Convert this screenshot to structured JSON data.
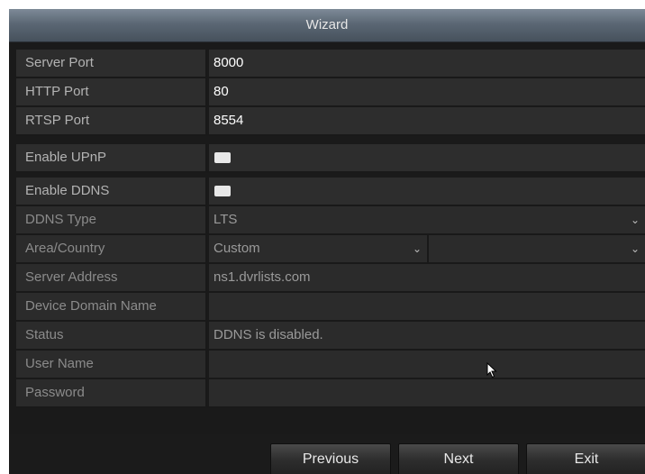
{
  "window": {
    "title": "Wizard"
  },
  "network": {
    "server_port": {
      "label": "Server Port",
      "value": "8000"
    },
    "http_port": {
      "label": "HTTP Port",
      "value": "80"
    },
    "rtsp_port": {
      "label": "RTSP Port",
      "value": "8554"
    }
  },
  "upnp": {
    "label": "Enable UPnP",
    "checked": false
  },
  "ddns": {
    "enable_label": "Enable DDNS",
    "enabled": false,
    "type": {
      "label": "DDNS Type",
      "value": "LTS"
    },
    "area": {
      "label": "Area/Country",
      "value": "Custom",
      "secondary_value": ""
    },
    "server_address": {
      "label": "Server Address",
      "value": "ns1.dvrlists.com"
    },
    "device_domain": {
      "label": "Device Domain Name",
      "value": ""
    },
    "status": {
      "label": "Status",
      "value": "DDNS is disabled."
    },
    "user_name": {
      "label": "User Name",
      "value": ""
    },
    "password": {
      "label": "Password",
      "value": ""
    }
  },
  "buttons": {
    "previous": "Previous",
    "next": "Next",
    "exit": "Exit"
  },
  "icons": {
    "dropdown": "chevron-down-icon",
    "cursor": "mouse-pointer-icon"
  },
  "colors": {
    "panel": "#2d2d2d",
    "title_bar": "#5b6774",
    "text": "#ffffff",
    "label": "#b3b3b3"
  }
}
